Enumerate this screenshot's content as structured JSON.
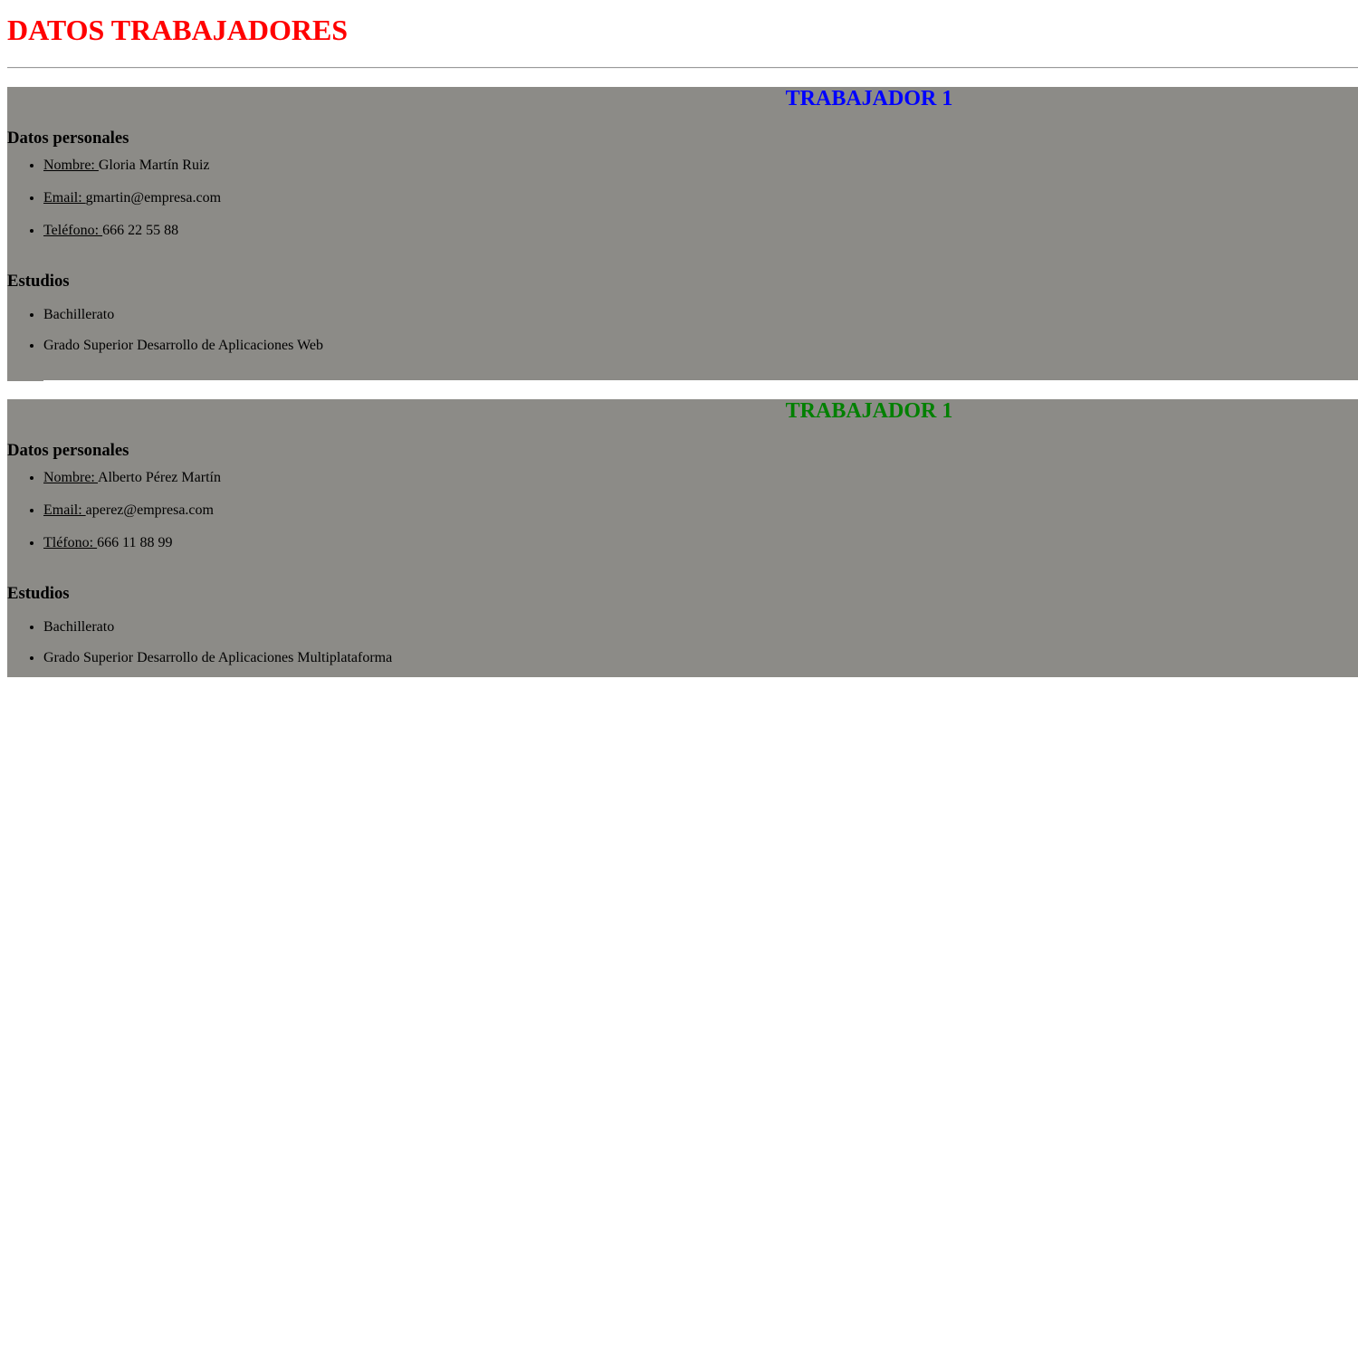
{
  "page": {
    "title": "DATOS TRABAJADORES"
  },
  "workers": [
    {
      "title": "TRABAJADOR 1",
      "title_color": "#0000ff",
      "personal_heading": "Datos personales",
      "fields": [
        {
          "label": "Nombre: ",
          "value": "Gloria Martín Ruiz"
        },
        {
          "label": "Email: ",
          "value": "gmartin@empresa.com"
        },
        {
          "label": "Teléfono: ",
          "value": "666 22 55 88"
        }
      ],
      "studies_heading": "Estudios",
      "studies": [
        "Bachillerato",
        "Grado Superior Desarrollo de Aplicaciones Web"
      ]
    },
    {
      "title": "TRABAJADOR 1",
      "title_color": "#008000",
      "personal_heading": "Datos personales",
      "fields": [
        {
          "label": "Nombre: ",
          "value": "Alberto Pérez Martín"
        },
        {
          "label": "Email: ",
          "value": "aperez@empresa.com"
        },
        {
          "label": "Tléfono: ",
          "value": "666 11 88 99"
        }
      ],
      "studies_heading": "Estudios",
      "studies": [
        "Bachillerato",
        "Grado Superior Desarrollo de Aplicaciones Multiplataforma"
      ]
    }
  ],
  "colors": {
    "page_title": "#ff0000",
    "panel_background": "#8c8b87"
  }
}
